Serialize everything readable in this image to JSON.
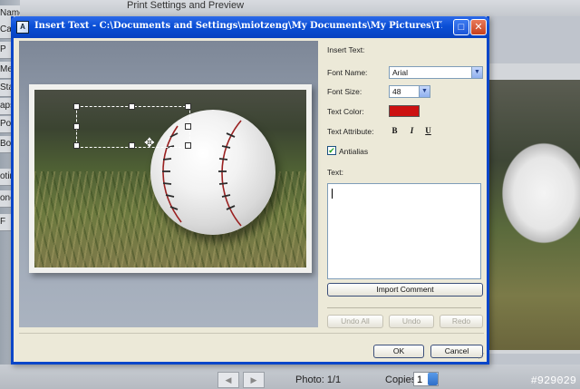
{
  "background": {
    "top_text": "Print Settings and Preview",
    "left_items": [
      "Name",
      "Cance",
      "P",
      "Medi",
      "Stan",
      "aps",
      "Post",
      "Bo",
      "otin",
      "one",
      "F"
    ],
    "photo_counter": "Photo: 1/1",
    "copies_label": "Copies:",
    "copies_value": "1",
    "watermark": "#929029"
  },
  "dialog": {
    "title": "Insert Text - C:\\Documents and Settings\\miotzeng\\My Documents\\My Pictures\\Thai photographic cl...",
    "fields": {
      "insert_text_label": "Insert Text:",
      "font_name_label": "Font Name:",
      "font_name_value": "Arial",
      "font_size_label": "Font Size:",
      "font_size_value": "48",
      "text_color_label": "Text Color:",
      "text_color_value": "#cc1111",
      "text_attribute_label": "Text Attribute:",
      "bold_label": "B",
      "italic_label": "I",
      "underline_label": "U",
      "antialias_label": "Antialias",
      "antialias_checked": true,
      "text_label": "Text:",
      "text_value": ""
    },
    "buttons": {
      "import_comment": "Import Comment",
      "undo_all": "Undo All",
      "undo": "Undo",
      "redo": "Redo",
      "ok": "OK",
      "cancel": "Cancel"
    }
  },
  "colors": {
    "titlebar": "#0a4fd6",
    "dialog_bg": "#ece9d8",
    "accent_border": "#7f9db9"
  }
}
